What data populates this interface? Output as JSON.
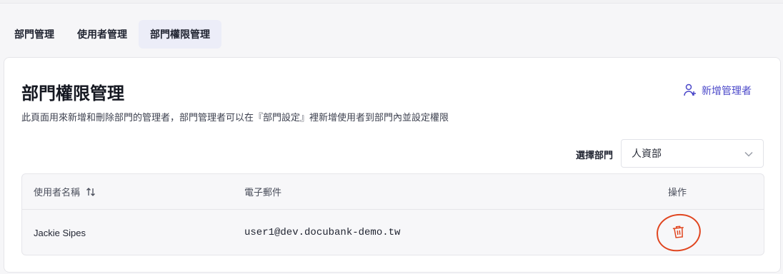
{
  "tabs": [
    {
      "label": "部門管理",
      "active": false
    },
    {
      "label": "使用者管理",
      "active": false
    },
    {
      "label": "部門權限管理",
      "active": true
    }
  ],
  "page": {
    "title": "部門權限管理",
    "description": "此頁面用來新增和刪除部門的管理者，部門管理者可以在『部門設定』裡新增使用者到部門內並設定權限",
    "add_button_label": "新增管理者",
    "add_button_icon": "add-user-icon"
  },
  "filter": {
    "label": "選擇部門",
    "selected": "人資部",
    "icon": "chevron-down-icon"
  },
  "table": {
    "columns": [
      "使用者名稱",
      "電子郵件",
      "操作"
    ],
    "sort_icon": "sort-icon",
    "rows": [
      {
        "name": "Jackie Sipes",
        "email": "user1@dev.docubank-demo.tw",
        "action_icon": "trash-icon"
      }
    ]
  },
  "colors": {
    "accent": "#4b48c9",
    "danger": "#e0451f",
    "active_tab_bg": "#ecedf8"
  }
}
